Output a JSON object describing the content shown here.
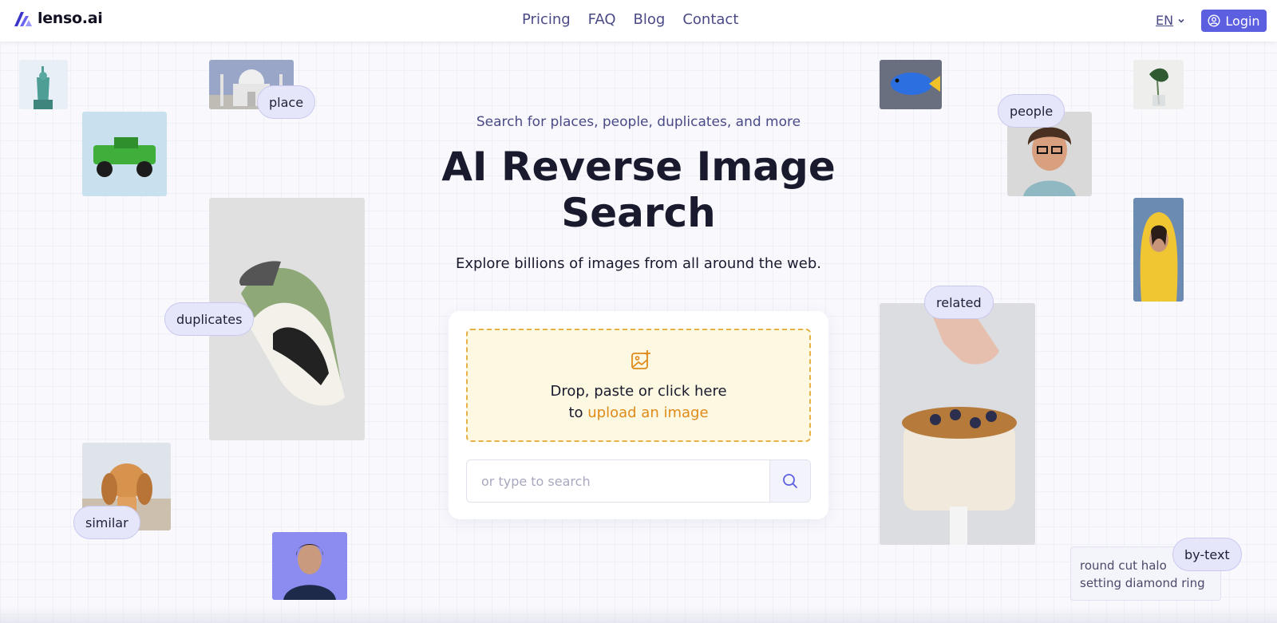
{
  "header": {
    "logo_text": "lenso.ai",
    "nav": [
      "Pricing",
      "FAQ",
      "Blog",
      "Contact"
    ],
    "language": "EN",
    "login_label": "Login"
  },
  "hero": {
    "subtitle": "Search for places, people, duplicates, and more",
    "title": "AI Reverse Image Search",
    "description": "Explore billions of images from all around the web."
  },
  "upload": {
    "line1": "Drop, paste or click here",
    "line2_prefix": "to ",
    "line2_link": "upload an image"
  },
  "search": {
    "placeholder": "or type to search"
  },
  "tags": {
    "place": "place",
    "duplicates": "duplicates",
    "similar": "similar",
    "people": "people",
    "related": "related",
    "by_text": "by-text"
  },
  "by_text_sample": {
    "line1": "round cut halo",
    "line2": "setting diamond ring"
  },
  "colors": {
    "brand": "#5b5fe0",
    "accent": "#e08a1a",
    "nav_text": "#4a4a86",
    "drop_bg": "#fcf8e1"
  },
  "icons": {
    "logo": "lenso-logo-icon",
    "language_toggle": "chevron-down-icon",
    "login": "user-circle-icon",
    "upload": "image-plus-icon",
    "search": "search-icon"
  }
}
